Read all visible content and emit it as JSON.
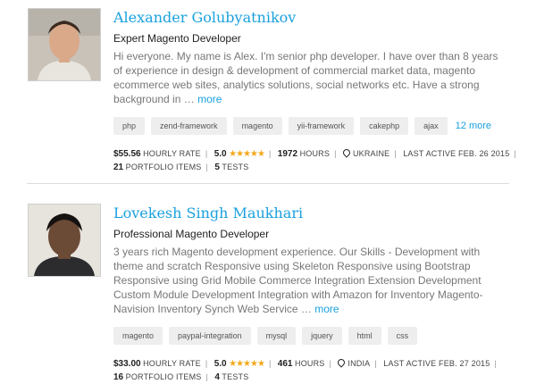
{
  "freelancers": [
    {
      "name": "Alexander Golubyatnikov",
      "title": "Expert Magento Developer",
      "bio": "Hi everyone. My name is Alex. I'm senior php developer. I have over than 8 years of experience in design & development of commercial market data, magento ecommerce web sites, analytics solutions, social networks etc. Have a strong background in  …",
      "bio_more": "more",
      "tags": [
        "php",
        "zend-framework",
        "magento",
        "yii-framework",
        "cakephp",
        "ajax"
      ],
      "more_tags": "12 more",
      "rate": "$55.56",
      "rate_label": "HOURLY RATE",
      "rating": "5.0",
      "stars": "★★★★★",
      "hours": "1972",
      "hours_label": "HOURS",
      "location": "UKRAINE",
      "last_active": "LAST ACTIVE FEB. 26 2015",
      "portfolio": "21",
      "portfolio_label": "PORTFOLIO ITEMS",
      "tests": "5",
      "tests_label": "TESTS"
    },
    {
      "name": "Lovekesh Singh Maukhari",
      "title": "Professional Magento Developer",
      "bio": "3 years rich Magento development experience. Our Skills - Development with theme and scratch Responsive using Skeleton Responsive using Bootstrap Responsive using Grid Mobile Commerce Integration Extension Development Custom Module Development Integration with Amazon for Inventory Magento-Navision Inventory Synch Web Service  …",
      "bio_more": "more",
      "tags": [
        "magento",
        "paypal-integration",
        "mysql",
        "jquery",
        "html",
        "css"
      ],
      "more_tags": "",
      "rate": "$33.00",
      "rate_label": "HOURLY RATE",
      "rating": "5.0",
      "stars": "★★★★★",
      "hours": "461",
      "hours_label": "HOURS",
      "location": "INDIA",
      "last_active": "LAST ACTIVE FEB. 27 2015",
      "portfolio": "16",
      "portfolio_label": "PORTFOLIO ITEMS",
      "tests": "4",
      "tests_label": "TESTS"
    }
  ],
  "colors": {
    "accent": "#1aa1de",
    "star": "#f2a81a",
    "tag_bg": "#eeeeee"
  }
}
